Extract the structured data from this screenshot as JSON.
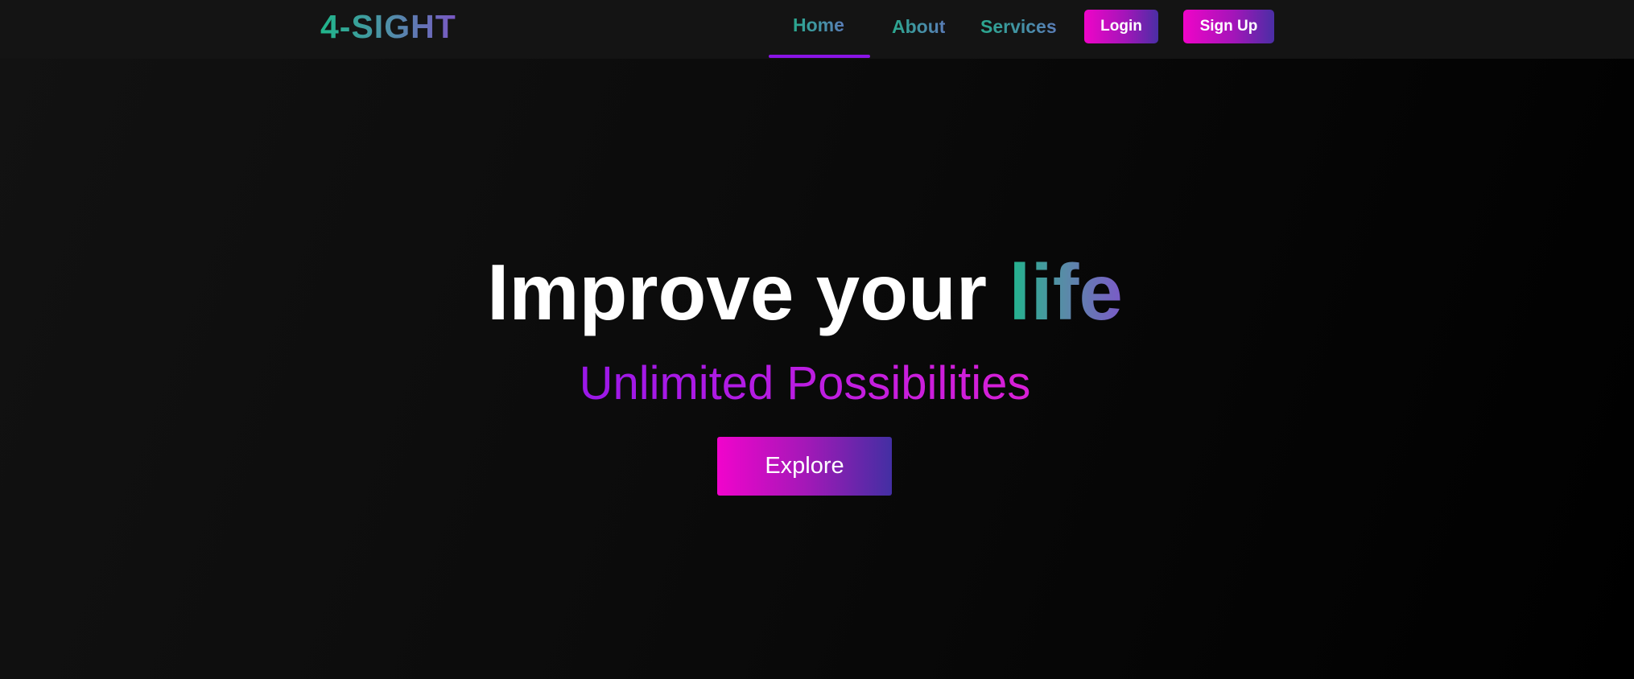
{
  "header": {
    "brand": "4-SIGHT",
    "nav": {
      "home": "Home",
      "about": "About",
      "services": "Services"
    },
    "active_tab": "home",
    "login_label": "Login",
    "signup_label": "Sign Up"
  },
  "hero": {
    "title_main": "Improve your ",
    "title_accent": "life",
    "subtitle": "Unlimited Possibilities",
    "cta_label": "Explore"
  },
  "colors": {
    "background": "#0b0b0b",
    "navbar": "#141414",
    "accent_teal": "#20b58c",
    "accent_purple": "#7b5ac8",
    "accent_magenta": "#f004c8",
    "active_underline": "#8a14e6",
    "subtitle_purple": "#9a18e8"
  }
}
